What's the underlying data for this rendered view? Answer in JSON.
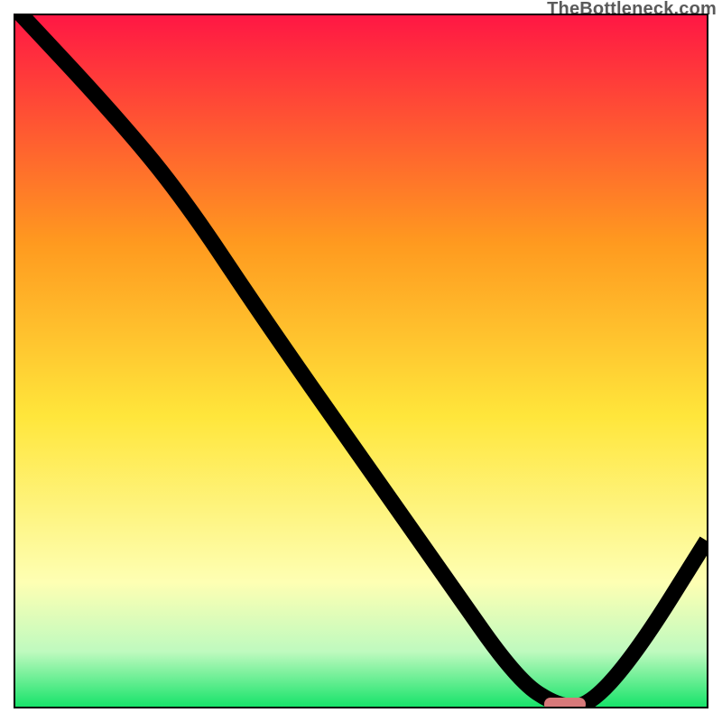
{
  "watermark": "TheBottleneck.com",
  "colors": {
    "red": "#ff1744",
    "orange": "#ff9a1f",
    "yellow": "#ffe63b",
    "paleYellow": "#feffb3",
    "paleGreen": "#bffabf",
    "green": "#17e36a",
    "marker": "#d7797a"
  },
  "chart_data": {
    "type": "line",
    "title": "",
    "xlabel": "",
    "ylabel": "",
    "xlim": [
      0,
      100
    ],
    "ylim": [
      0,
      100
    ],
    "series": [
      {
        "name": "bottleneck-curve",
        "x": [
          0,
          14,
          24,
          36,
          50,
          62,
          72.5,
          78.5,
          83,
          90,
          100
        ],
        "y": [
          101,
          86,
          74,
          56,
          36,
          19,
          4,
          0,
          0,
          8,
          24
        ]
      }
    ],
    "annotations": [
      {
        "name": "optimal-marker",
        "x_range": [
          76.5,
          82.5
        ],
        "y": 0
      }
    ],
    "gradient_stops": [
      {
        "pos": 0.0,
        "color_key": "red"
      },
      {
        "pos": 0.33,
        "color_key": "orange"
      },
      {
        "pos": 0.58,
        "color_key": "yellow"
      },
      {
        "pos": 0.82,
        "color_key": "paleYellow"
      },
      {
        "pos": 0.92,
        "color_key": "paleGreen"
      },
      {
        "pos": 1.0,
        "color_key": "green"
      }
    ]
  }
}
